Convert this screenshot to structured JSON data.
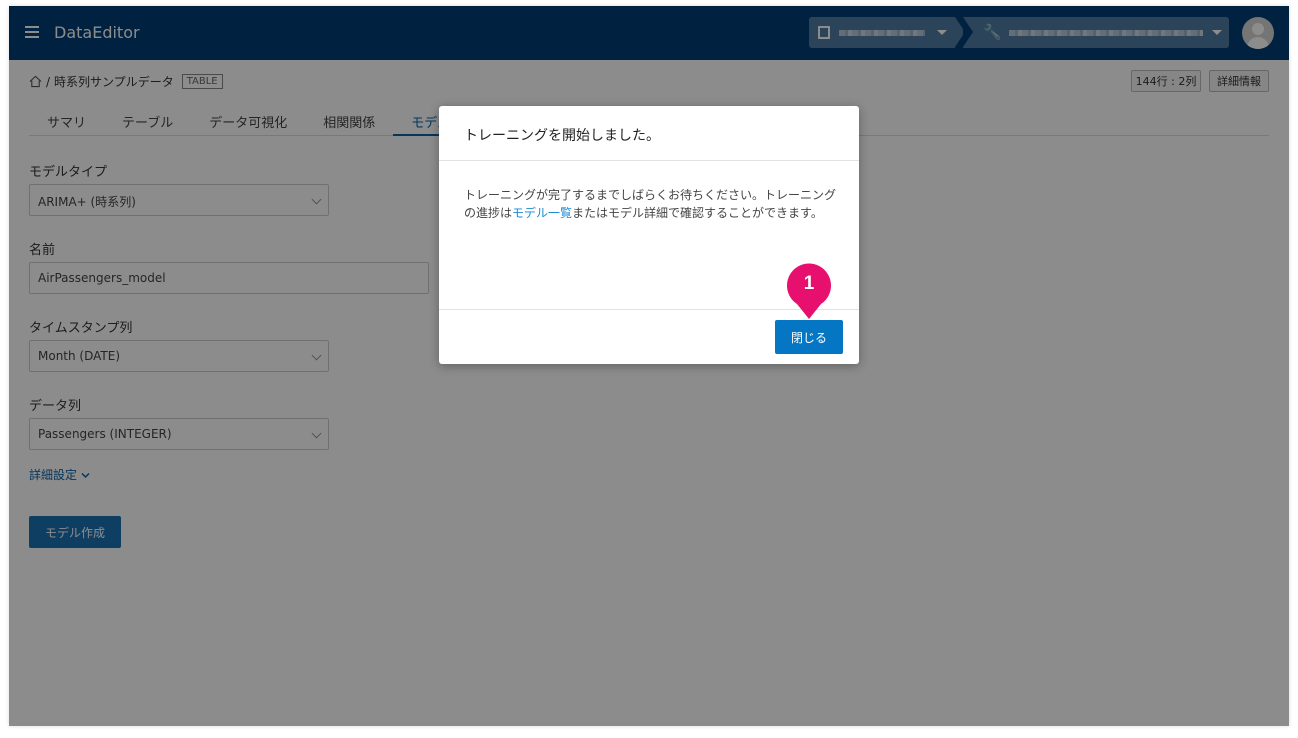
{
  "header": {
    "app_title": "DataEditor",
    "org_selector": "organization-selector (blurred)",
    "project_selector": "project-selector (blurred)"
  },
  "breadcrumb": {
    "separator": "/",
    "dataset_name": "時系列サンプルデータ",
    "badge": "TABLE"
  },
  "toolbar": {
    "size_label": "144行 : 2列",
    "detail_label": "詳細情報"
  },
  "tabs": [
    {
      "label": "サマリ"
    },
    {
      "label": "テーブル"
    },
    {
      "label": "データ可視化"
    },
    {
      "label": "相関関係"
    },
    {
      "label": "モデル作成"
    }
  ],
  "form": {
    "model_type_label": "モデルタイプ",
    "model_type_value": "ARIMA+ (時系列)",
    "name_label": "名前",
    "name_value": "AirPassengers_model",
    "timestamp_label": "タイムスタンプ列",
    "timestamp_value": "Month (DATE)",
    "data_col_label": "データ列",
    "data_col_value": "Passengers (INTEGER)",
    "advanced_label": "詳細設定",
    "create_label": "モデル作成"
  },
  "modal": {
    "title": "トレーニングを開始しました。",
    "body_pre": "トレーニングが完了するまでしばらくお待ちください。トレーニングの進捗は",
    "body_link": "モデル一覧",
    "body_post": "またはモデル詳細で確認することができます。",
    "close_label": "閉じる"
  },
  "annotation": {
    "step": "1",
    "color": "#e8106f"
  },
  "colors": {
    "header_bg": "#003f75",
    "primary": "#0576c3"
  }
}
